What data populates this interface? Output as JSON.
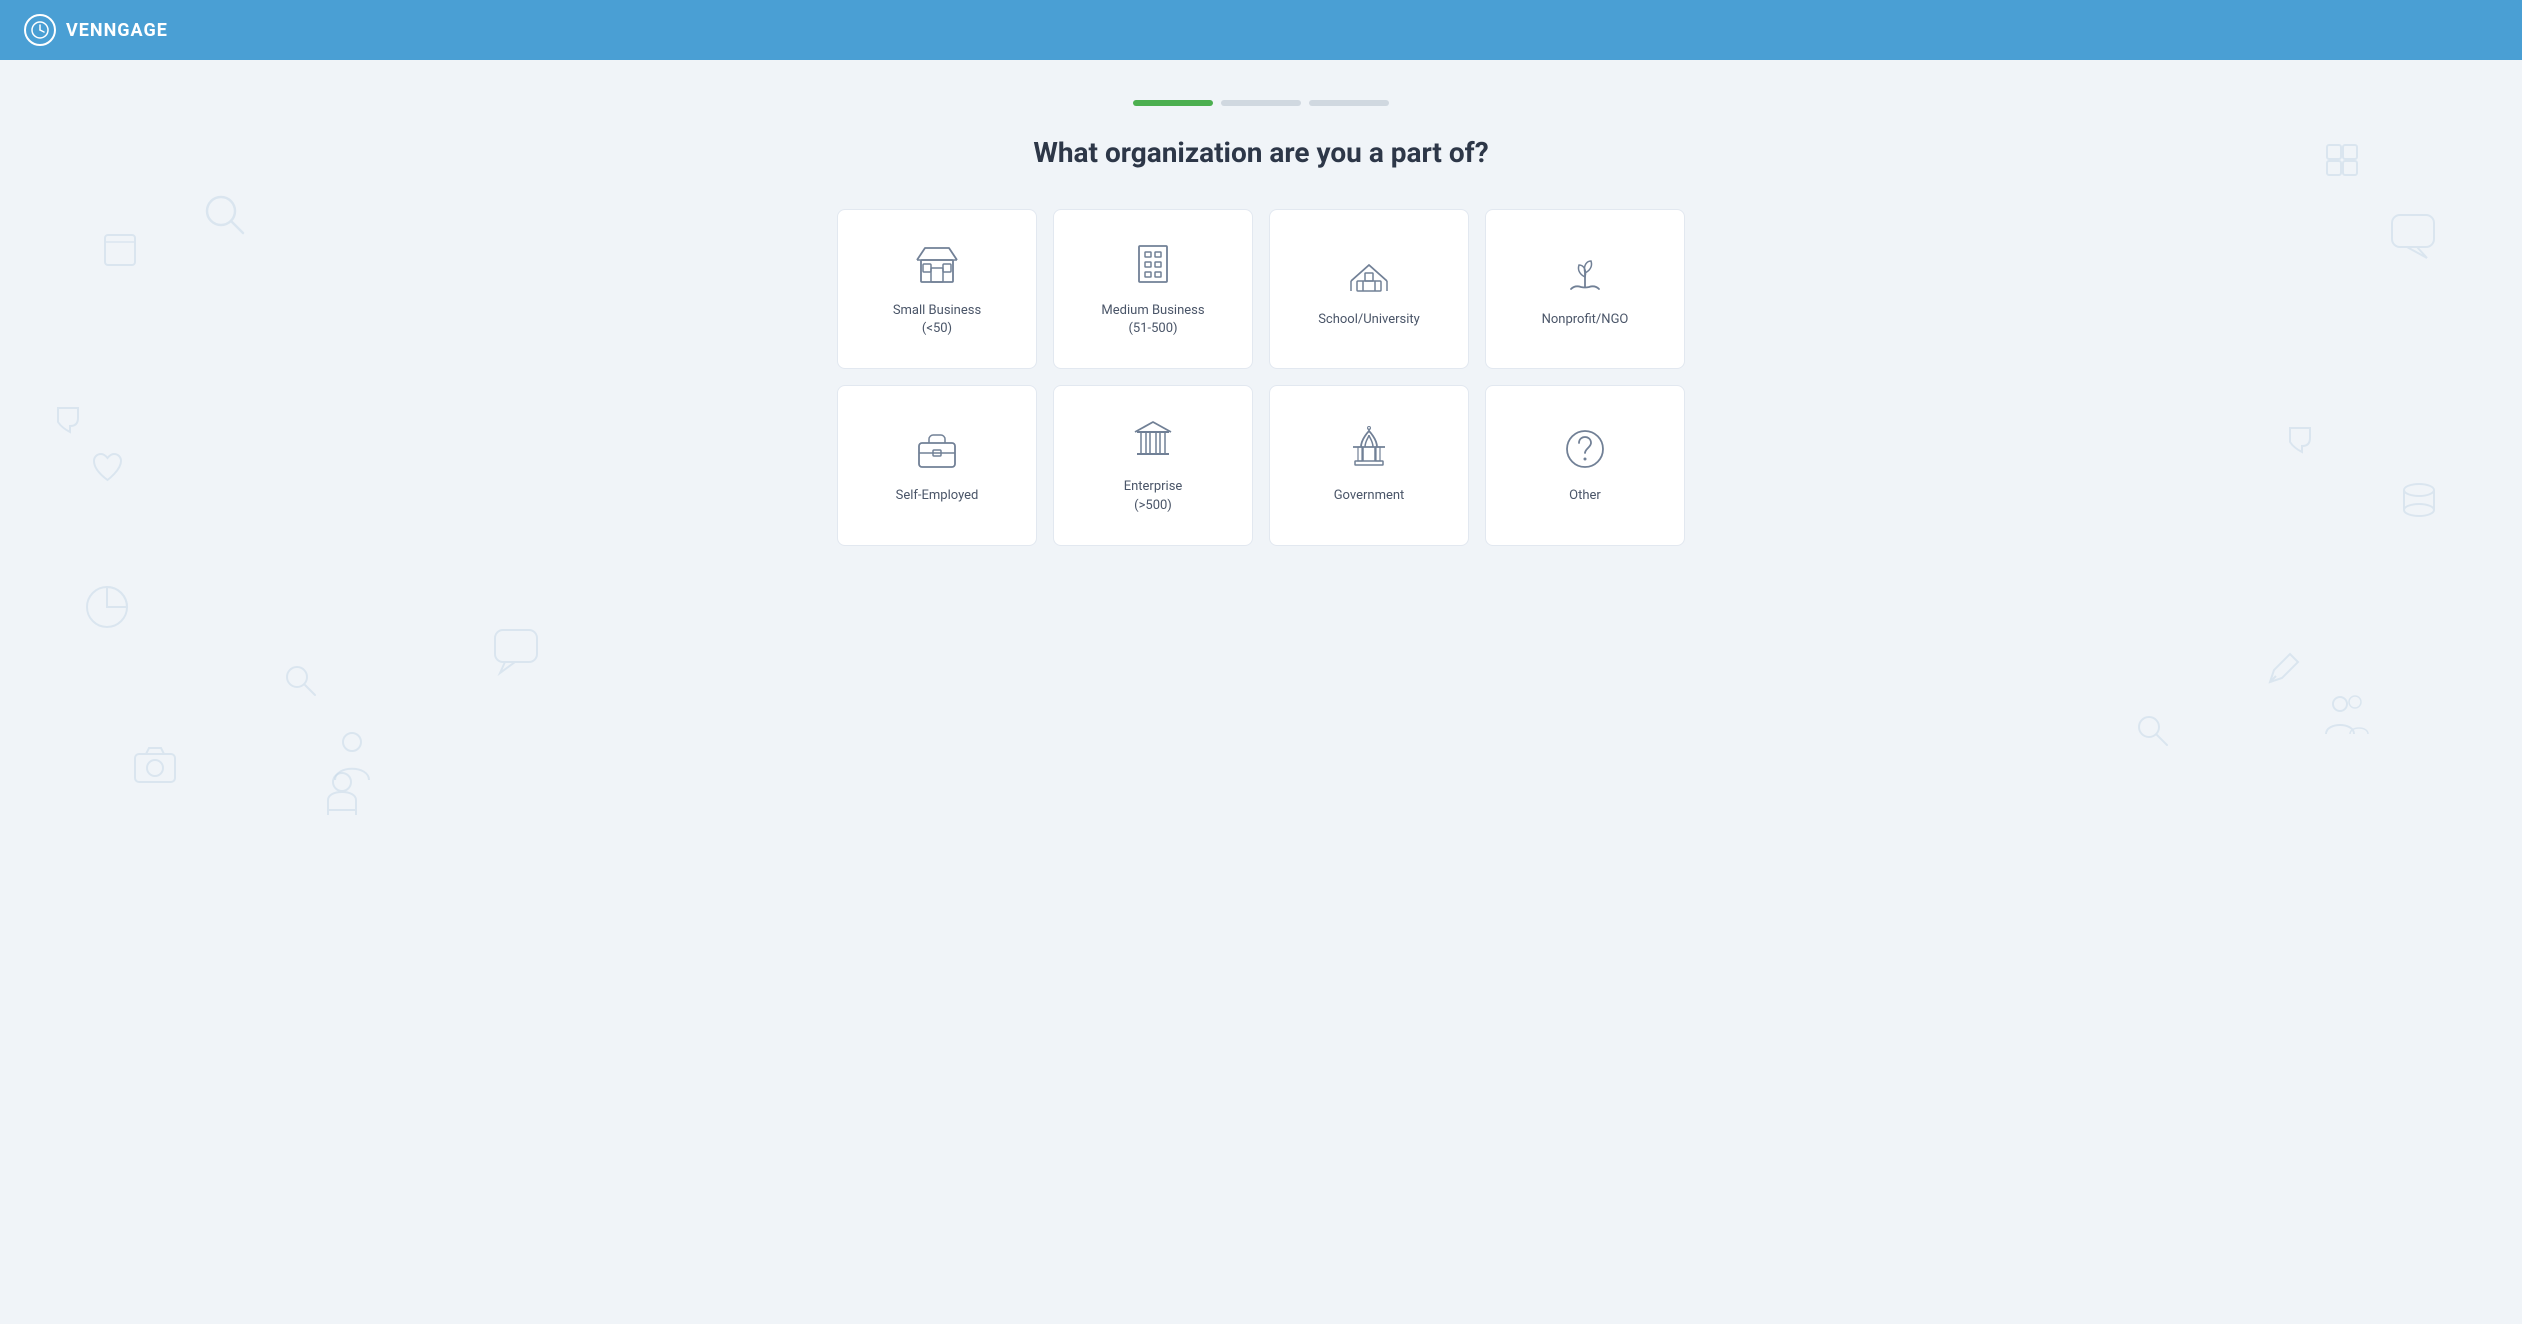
{
  "header": {
    "logo_text": "VENNGAGE",
    "logo_icon": "clock"
  },
  "progress": {
    "segments": [
      {
        "state": "active"
      },
      {
        "state": "inactive"
      },
      {
        "state": "inactive"
      }
    ]
  },
  "page": {
    "title": "What organization are you a part of?",
    "options": [
      {
        "id": "small-business",
        "label": "Small Business\n(<50)",
        "label_line1": "Small Business",
        "label_line2": "(<50)",
        "icon": "store"
      },
      {
        "id": "medium-business",
        "label": "Medium Business\n(51-500)",
        "label_line1": "Medium Business",
        "label_line2": "(51-500)",
        "icon": "building"
      },
      {
        "id": "school-university",
        "label": "School/University",
        "label_line1": "School/University",
        "label_line2": "",
        "icon": "school"
      },
      {
        "id": "nonprofit-ngo",
        "label": "Nonprofit/NGO",
        "label_line1": "Nonprofit/NGO",
        "label_line2": "",
        "icon": "nonprofit"
      },
      {
        "id": "self-employed",
        "label": "Self-Employed",
        "label_line1": "Self-Employed",
        "label_line2": "",
        "icon": "briefcase"
      },
      {
        "id": "enterprise",
        "label": "Enterprise\n(>500)",
        "label_line1": "Enterprise",
        "label_line2": "(>500)",
        "icon": "enterprise"
      },
      {
        "id": "government",
        "label": "Government",
        "label_line1": "Government",
        "label_line2": "",
        "icon": "government"
      },
      {
        "id": "other",
        "label": "Other",
        "label_line1": "Other",
        "label_line2": "",
        "icon": "question"
      }
    ]
  }
}
